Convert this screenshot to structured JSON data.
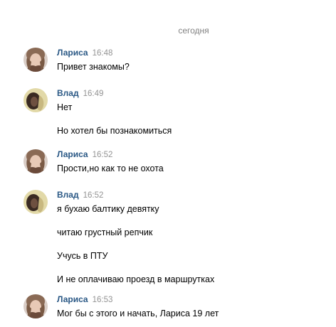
{
  "date_separator": "сегодня",
  "messages": [
    {
      "author": "Лариса",
      "time": "16:48",
      "avatar": "larisa-avatar",
      "lines": [
        "Привет знакомы?"
      ]
    },
    {
      "author": "Влад",
      "time": "16:49",
      "avatar": "vlad-avatar",
      "lines": [
        "Нет",
        "Но хотел бы познакомиться"
      ]
    },
    {
      "author": "Лариса",
      "time": "16:52",
      "avatar": "larisa-avatar",
      "lines": [
        "Прости,но как то не охота"
      ]
    },
    {
      "author": "Влад",
      "time": "16:52",
      "avatar": "vlad-avatar",
      "lines": [
        "я бухаю балтику девятку",
        "читаю грустный репчик",
        "Учусь в ПТУ",
        "И не оплачиваю проезд в маршрутках"
      ]
    },
    {
      "author": "Лариса",
      "time": "16:53",
      "avatar": "larisa-avatar",
      "lines": [
        "Мог бы с этого и начать, Лариса 19 лет"
      ]
    }
  ],
  "colors": {
    "author_link": "#2a5885",
    "timestamp": "#939393",
    "date_separator": "#828282"
  }
}
